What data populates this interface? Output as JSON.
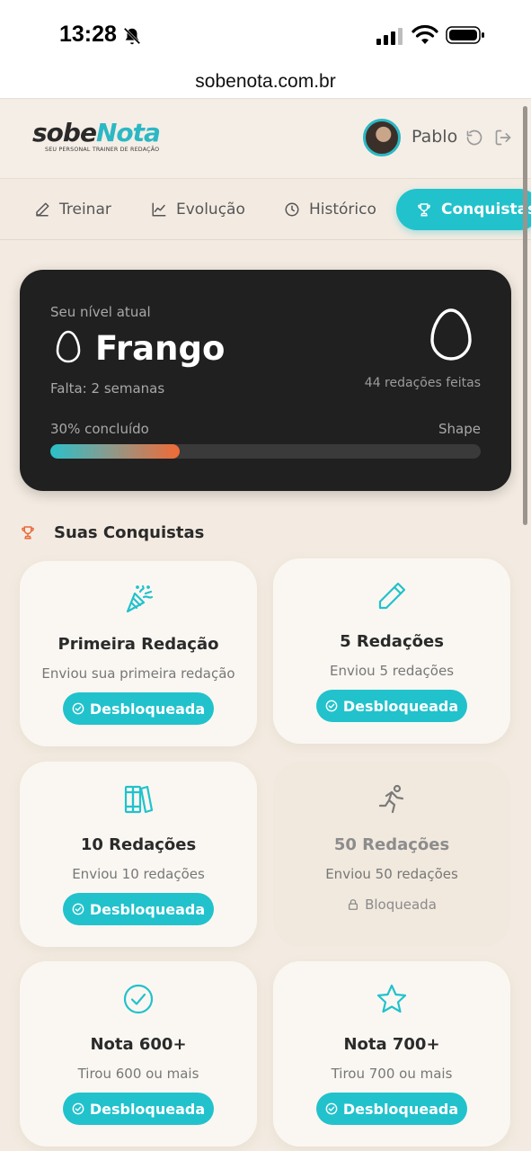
{
  "status_bar": {
    "time": "13:28"
  },
  "browser": {
    "url": "sobenota.com.br"
  },
  "header": {
    "logo": {
      "sobe": "sobe",
      "nota": "Nota",
      "tagline": "SEU PERSONAL TRAINER DE REDAÇÃO"
    },
    "user_name": "Pablo"
  },
  "tabs": [
    {
      "label": "Treinar",
      "icon": "pencil-icon"
    },
    {
      "label": "Evolução",
      "icon": "chart-line-icon"
    },
    {
      "label": "Histórico",
      "icon": "clock-icon"
    },
    {
      "label": "Conquistas",
      "icon": "trophy-icon",
      "active": true
    }
  ],
  "level": {
    "label": "Seu nível atual",
    "name": "Frango",
    "remaining": "Falta: 2 semanas",
    "count_text": "44 redações feitas",
    "progress_text": "30% concluído",
    "progress": 0.3,
    "next_level": "Shape"
  },
  "achievements_section": {
    "title": "Suas Conquistas"
  },
  "achievements": [
    {
      "title": "Primeira Redação",
      "desc": "Enviou sua primeira redação",
      "status": "Desbloqueada",
      "icon": "party-popper-icon",
      "unlocked": true
    },
    {
      "title": "5 Redações",
      "desc": "Enviou 5 redações",
      "status": "Desbloqueada",
      "icon": "pencil-icon",
      "unlocked": true
    },
    {
      "title": "10 Redações",
      "desc": "Enviou 10 redações",
      "status": "Desbloqueada",
      "icon": "books-icon",
      "unlocked": true
    },
    {
      "title": "50 Redações",
      "desc": "Enviou 50 redações",
      "status": "Bloqueada",
      "icon": "runner-icon",
      "unlocked": false
    },
    {
      "title": "Nota 600+",
      "desc": "Tirou 600 ou mais",
      "status": "Desbloqueada",
      "icon": "check-circle-icon",
      "unlocked": true
    },
    {
      "title": "Nota 700+",
      "desc": "Tirou 700 ou mais",
      "status": "Desbloqueada",
      "icon": "star-icon",
      "unlocked": true
    }
  ],
  "colors": {
    "accent": "#21c2cc",
    "progress_end": "#f06a35",
    "card_dark": "#202020"
  }
}
